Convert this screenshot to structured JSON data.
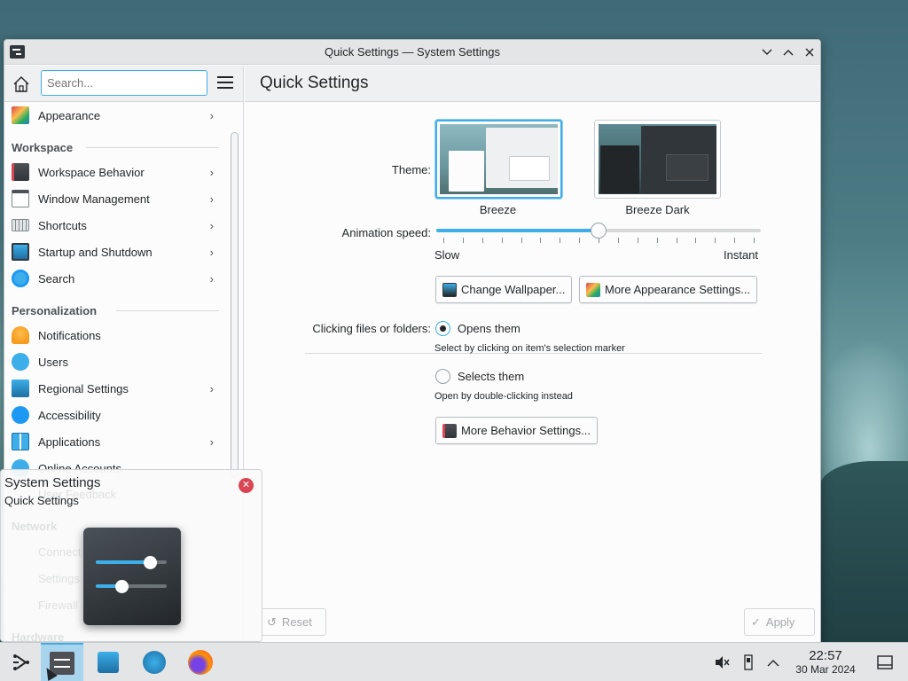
{
  "window": {
    "title": "Quick Settings — System Settings"
  },
  "sidebar": {
    "search_placeholder": "Search...",
    "items_top": [
      {
        "label": "Appearance",
        "icon": "appearance-icon",
        "chevron": true
      }
    ],
    "category_workspace": "Workspace",
    "items_workspace": [
      {
        "label": "Workspace Behavior",
        "icon": "workspace-behavior-icon",
        "chevron": true
      },
      {
        "label": "Window Management",
        "icon": "window-management-icon",
        "chevron": true
      },
      {
        "label": "Shortcuts",
        "icon": "keyboard-icon",
        "chevron": true
      },
      {
        "label": "Startup and Shutdown",
        "icon": "startup-icon",
        "chevron": true
      },
      {
        "label": "Search",
        "icon": "search-icon",
        "chevron": true
      }
    ],
    "category_personalization": "Personalization",
    "items_personalization": [
      {
        "label": "Notifications",
        "icon": "bell-icon",
        "chevron": false
      },
      {
        "label": "Users",
        "icon": "users-icon",
        "chevron": false
      },
      {
        "label": "Regional Settings",
        "icon": "regional-icon",
        "chevron": true
      },
      {
        "label": "Accessibility",
        "icon": "accessibility-icon",
        "chevron": false
      },
      {
        "label": "Applications",
        "icon": "applications-icon",
        "chevron": true
      },
      {
        "label": "Online Accounts",
        "icon": "online-accounts-icon",
        "chevron": false
      }
    ]
  },
  "main": {
    "header": "Quick Settings",
    "theme_label": "Theme:",
    "themes": [
      {
        "name": "Breeze",
        "selected": true
      },
      {
        "name": "Breeze Dark",
        "selected": false
      }
    ],
    "animation_label": "Animation speed:",
    "animation_value": 0.5,
    "slow_label": "Slow",
    "instant_label": "Instant",
    "change_wallpaper": "Change Wallpaper...",
    "more_appearance": "More Appearance Settings...",
    "clicking_label": "Clicking files or folders:",
    "option_open": "Opens them",
    "option_open_hint": "Select by clicking on item's selection marker",
    "option_select": "Selects them",
    "option_select_hint": "Open by double-clicking instead",
    "more_behavior": "More Behavior Settings...",
    "reset": "Reset",
    "apply": "Apply"
  },
  "popup": {
    "title": "System Settings",
    "subtitle": "Quick Settings",
    "ghost_items": [
      "User Feedback",
      "Network",
      "Connect",
      "Settings",
      "Firewall",
      "Hardware"
    ]
  },
  "taskbar": {
    "time": "22:57",
    "date": "30 Mar 2024"
  },
  "colors": {
    "accent": "#3daee9",
    "close_red": "#da4453"
  }
}
